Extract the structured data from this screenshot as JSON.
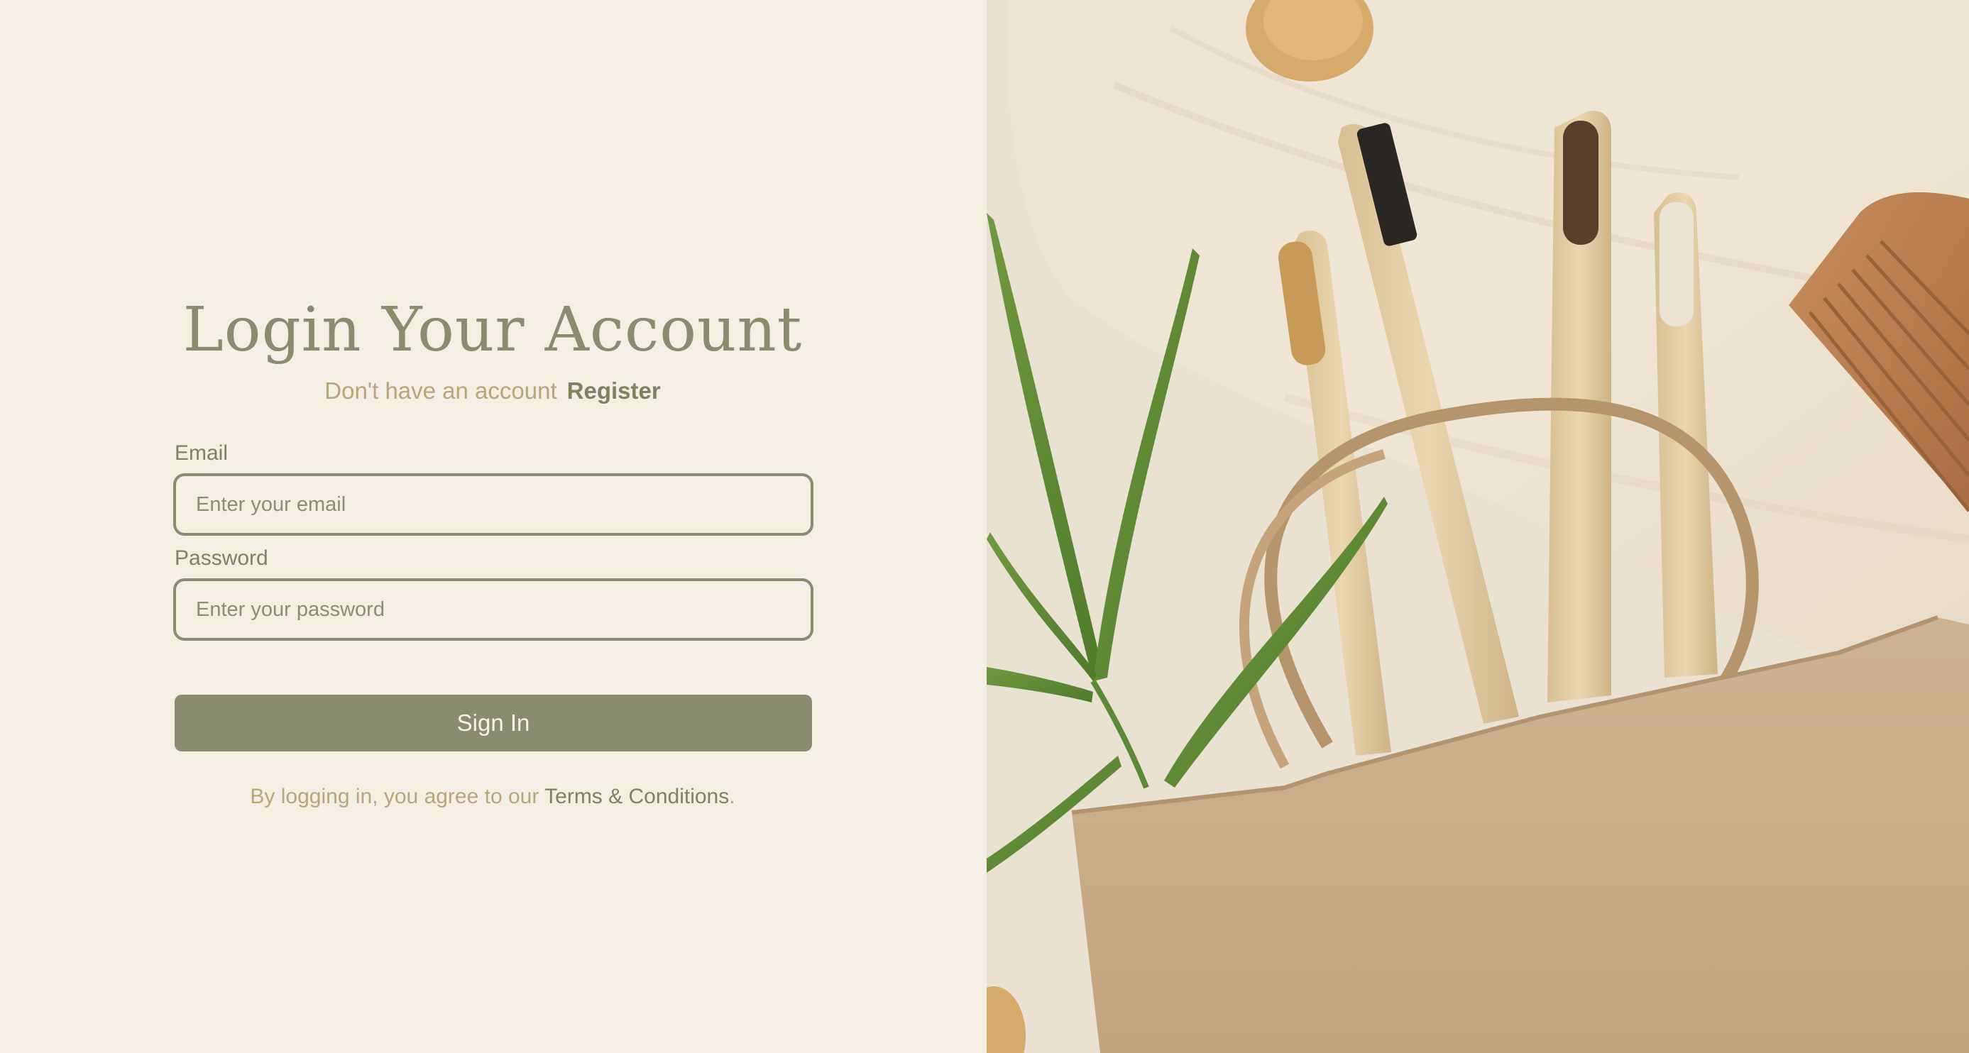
{
  "login": {
    "title": "Login Your Account",
    "subtitle_text": "Don't have an account",
    "register_link": "Register",
    "email_label": "Email",
    "email_placeholder": "Enter your email",
    "password_label": "Password",
    "password_placeholder": "Enter your password",
    "signin_label": "Sign In",
    "terms_prefix": "By logging in, you agree to our",
    "terms_link": "Terms & Conditions",
    "terms_suffix": "."
  },
  "theme": {
    "background": "#f4eee4",
    "accent": "#8a8c6e",
    "muted_text": "#b9a57b"
  },
  "hero_image": {
    "icon": "eco-bamboo-toothbrushes-photo"
  }
}
